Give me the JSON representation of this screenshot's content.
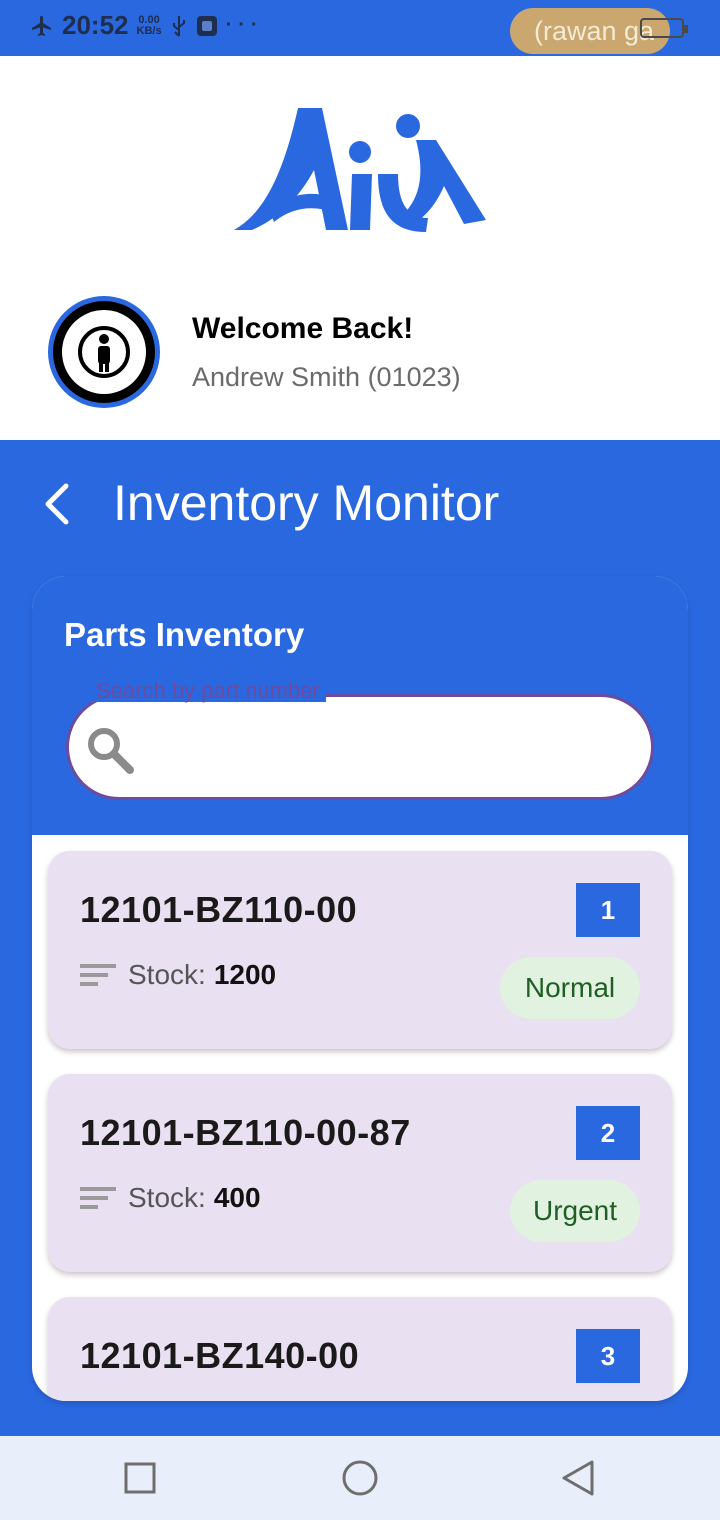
{
  "status_bar": {
    "time": "20:52",
    "speed_value": "0.00",
    "speed_unit": "KB/s",
    "notification_pill": "(rawan ga"
  },
  "header": {
    "welcome": "Welcome Back!",
    "user_name": "Andrew Smith (01023)"
  },
  "title_bar": {
    "title": "Inventory Monitor"
  },
  "panel": {
    "title": "Parts Inventory",
    "search_label": "Search by part number",
    "search_value": ""
  },
  "items": [
    {
      "part": "12101-BZ110-00",
      "stock_label": "Stock:",
      "stock": "1200",
      "index": "1",
      "status": "Normal"
    },
    {
      "part": "12101-BZ110-00-87",
      "stock_label": "Stock:",
      "stock": "400",
      "index": "2",
      "status": "Urgent"
    },
    {
      "part": "12101-BZ140-00",
      "stock_label": "Stock:",
      "stock": "",
      "index": "3",
      "status": ""
    }
  ],
  "colors": {
    "primary": "#2a68e0",
    "card": "#e9e0f1",
    "status_bg": "#e1f2e1",
    "status_text": "#1f5e24"
  },
  "icons": {
    "airplane": "airplane-icon",
    "back": "chevron-left-icon",
    "search": "search-icon",
    "stock": "sort-lines-icon",
    "nav_recent": "square-icon",
    "nav_home": "circle-icon",
    "nav_back": "triangle-back-icon"
  }
}
